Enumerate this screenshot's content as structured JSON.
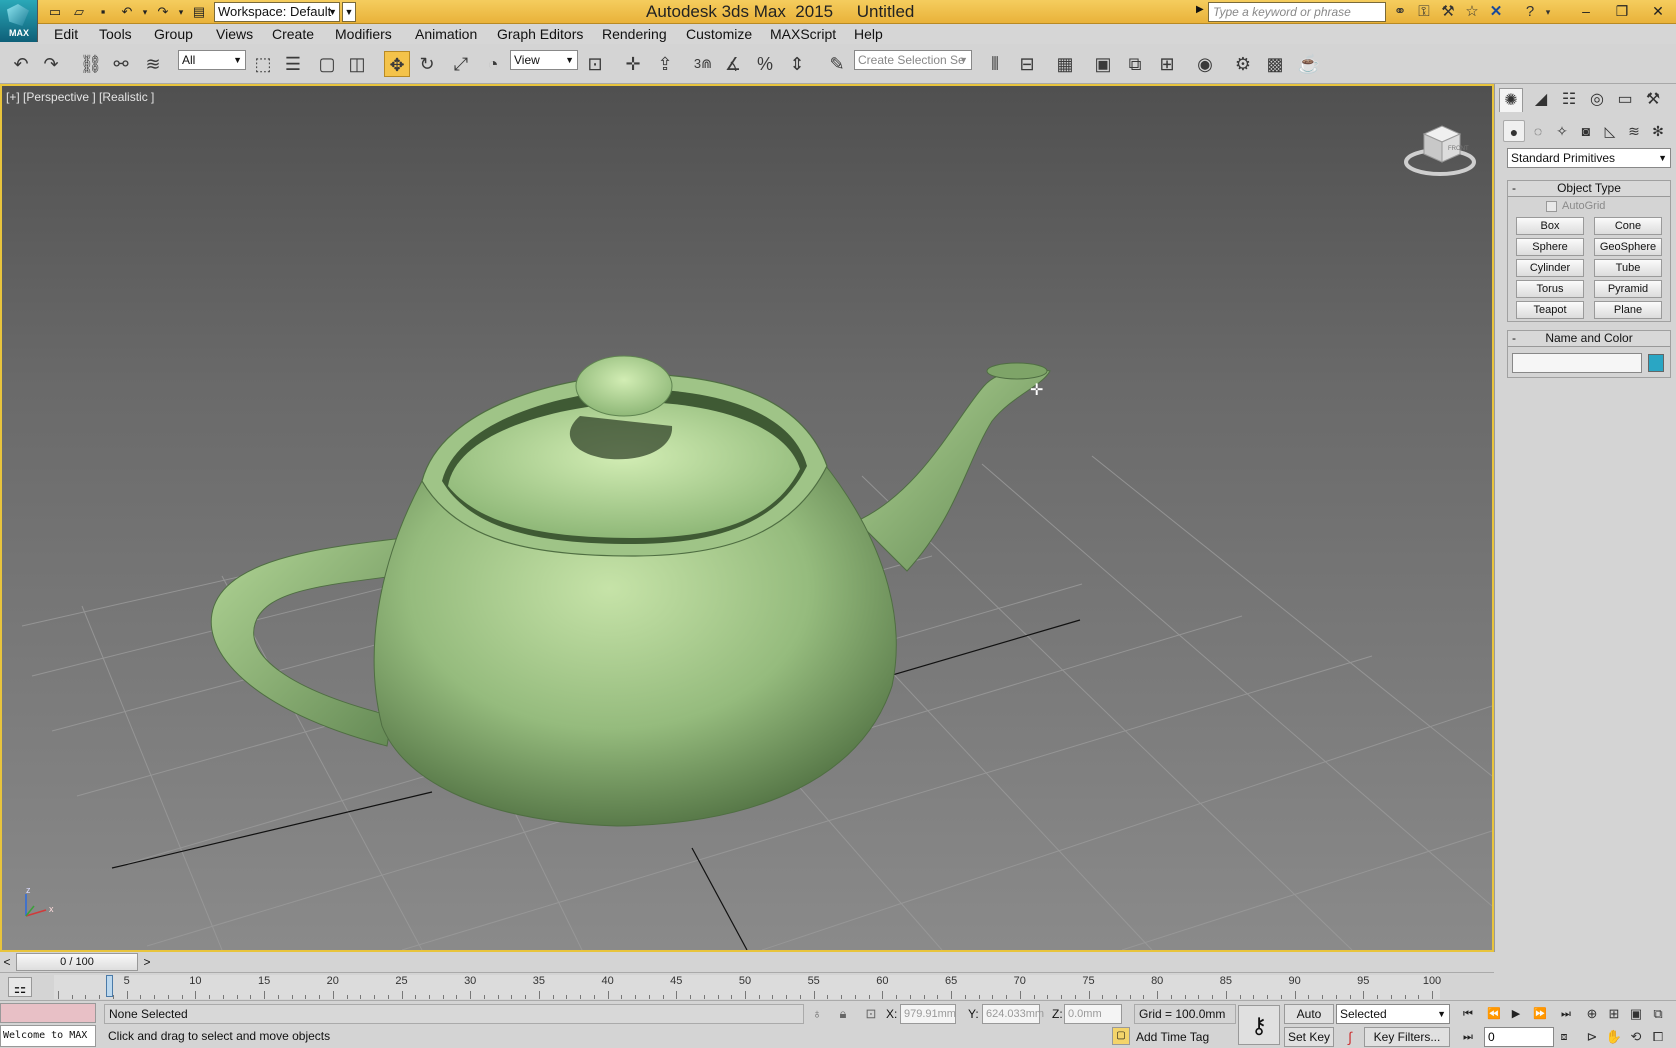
{
  "window": {
    "title": "Autodesk 3ds Max  2015     Untitled",
    "logo_text": "MAX",
    "workspace": "Workspace: Default",
    "search_placeholder": "Type a keyword or phrase"
  },
  "menu": [
    "Edit",
    "Tools",
    "Group",
    "Views",
    "Create",
    "Modifiers",
    "Animation",
    "Graph Editors",
    "Rendering",
    "Customize",
    "MAXScript",
    "Help"
  ],
  "toolbar": {
    "filter": "All",
    "ref_coord": "View",
    "snap_label": "3",
    "selection_set_placeholder": "Create Selection Se"
  },
  "viewport": {
    "label": "[+] [Perspective ] [Realistic ]",
    "viewcube_label": "FRONT",
    "axis_x": "x",
    "axis_z": "z",
    "teapot_color": "#a5c98d",
    "bg_top": "#505050",
    "bg_bottom": "#8a8a8a"
  },
  "command_panel": {
    "category": "Standard Primitives",
    "object_type": {
      "header": "Object Type",
      "autogrid": "AutoGrid",
      "buttons": [
        "Box",
        "Cone",
        "Sphere",
        "GeoSphere",
        "Cylinder",
        "Tube",
        "Torus",
        "Pyramid",
        "Teapot",
        "Plane"
      ]
    },
    "name_and_color": {
      "header": "Name and Color",
      "name_value": "",
      "swatch_color": "#2aa6c4"
    }
  },
  "time_slider": {
    "position": "0 / 100",
    "left_arrow": "<",
    "right_arrow": ">",
    "ticks": [
      "5",
      "10",
      "15",
      "20",
      "25",
      "30",
      "35",
      "40",
      "45",
      "50",
      "55",
      "60",
      "65",
      "70",
      "75",
      "80",
      "85",
      "90",
      "95",
      "100"
    ]
  },
  "status": {
    "listener": "Welcome to MAX",
    "selection": "None Selected",
    "prompt": "Click and drag to select and move objects",
    "x_label": "X:",
    "x_value": "979.91mm",
    "y_label": "Y:",
    "y_value": "624.033mm",
    "z_label": "Z:",
    "z_value": "0.0mm",
    "grid": "Grid = 100.0mm",
    "add_time_tag": "Add Time Tag",
    "auto_key": "Auto Key",
    "set_key": "Set Key",
    "key_mode": "Selected",
    "key_filters": "Key Filters...",
    "current_frame": "0"
  }
}
